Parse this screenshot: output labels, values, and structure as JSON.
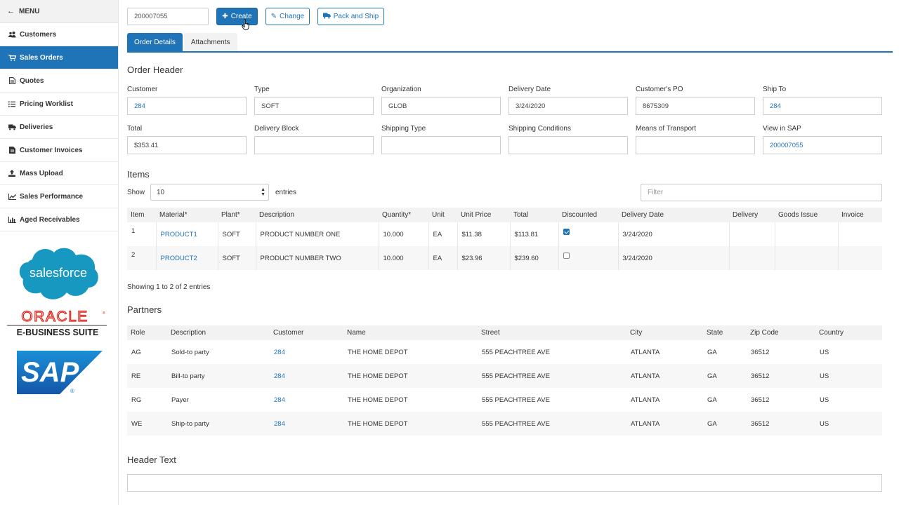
{
  "sidebar": {
    "menu_label": "MENU",
    "items": [
      {
        "label": "Customers",
        "icon": "users-icon",
        "active": false
      },
      {
        "label": "Sales Orders",
        "icon": "cart-icon",
        "active": true
      },
      {
        "label": "Quotes",
        "icon": "file-icon",
        "active": false
      },
      {
        "label": "Pricing Worklist",
        "icon": "list-icon",
        "active": false
      },
      {
        "label": "Deliveries",
        "icon": "truck-icon",
        "active": false
      },
      {
        "label": "Customer Invoices",
        "icon": "invoice-icon",
        "active": false
      },
      {
        "label": "Mass Upload",
        "icon": "upload-icon",
        "active": false
      },
      {
        "label": "Sales Performance",
        "icon": "line-chart-icon",
        "active": false
      },
      {
        "label": "Aged Receivables",
        "icon": "bar-chart-icon",
        "active": false
      }
    ],
    "logos": {
      "salesforce": "salesforce",
      "oracle_top": "ORACLE",
      "oracle_bottom": "E-BUSINESS SUITE",
      "sap": "SAP"
    }
  },
  "toolbar": {
    "order_number": "200007055",
    "create_label": "Create",
    "change_label": "Change",
    "pack_label": "Pack and Ship"
  },
  "tabs": {
    "order_details": "Order Details",
    "attachments": "Attachments"
  },
  "order_header": {
    "title": "Order Header",
    "customer_label": "Customer",
    "customer": "284",
    "type_label": "Type",
    "type": "SOFT",
    "org_label": "Organization",
    "org": "GLOB",
    "delivery_date_label": "Delivery Date",
    "delivery_date": "3/24/2020",
    "po_label": "Customer's PO",
    "po": "8675309",
    "ship_to_label": "Ship To",
    "ship_to": "284",
    "total_label": "Total",
    "total": "$353.41",
    "delivery_block_label": "Delivery Block",
    "delivery_block": "",
    "shipping_type_label": "Shipping Type",
    "shipping_type": "",
    "shipping_cond_label": "Shipping Conditions",
    "shipping_cond": "",
    "transport_label": "Means of Transport",
    "transport": "",
    "sap_label": "View in SAP",
    "sap": "200007055"
  },
  "items": {
    "title": "Items",
    "show_label": "Show",
    "page_size": "10",
    "entries_label": "entries",
    "filter_placeholder": "Filter",
    "columns": [
      "Item",
      "Material*",
      "Plant*",
      "Description",
      "Quantity*",
      "Unit",
      "Unit Price",
      "Total",
      "Discounted",
      "Delivery Date",
      "Delivery",
      "Goods Issue",
      "Invoice"
    ],
    "rows": [
      {
        "item": "1",
        "material": "PRODUCT1",
        "plant": "SOFT",
        "description": "PRODUCT NUMBER ONE",
        "quantity": "10.000",
        "unit": "EA",
        "unit_price": "$11.38",
        "total": "$113.81",
        "discounted": true,
        "delivery_date": "3/24/2020",
        "delivery": "",
        "goods_issue": "",
        "invoice": ""
      },
      {
        "item": "2",
        "material": "PRODUCT2",
        "plant": "SOFT",
        "description": "PRODUCT NUMBER TWO",
        "quantity": "10.000",
        "unit": "EA",
        "unit_price": "$23.96",
        "total": "$239.60",
        "discounted": false,
        "delivery_date": "3/24/2020",
        "delivery": "",
        "goods_issue": "",
        "invoice": ""
      }
    ],
    "showing_text": "Showing 1 to 2 of 2 entries"
  },
  "partners": {
    "title": "Partners",
    "columns": [
      "Role",
      "Description",
      "Customer",
      "Name",
      "Street",
      "City",
      "State",
      "Zip Code",
      "Country"
    ],
    "rows": [
      {
        "role": "AG",
        "description": "Sold-to party",
        "customer": "284",
        "name": "THE HOME DEPOT",
        "street": "555 PEACHTREE AVE",
        "city": "ATLANTA",
        "state": "GA",
        "zip": "36512",
        "country": "US"
      },
      {
        "role": "RE",
        "description": "Bill-to party",
        "customer": "284",
        "name": "THE HOME DEPOT",
        "street": "555 PEACHTREE AVE",
        "city": "ATLANTA",
        "state": "GA",
        "zip": "36512",
        "country": "US"
      },
      {
        "role": "RG",
        "description": "Payer",
        "customer": "284",
        "name": "THE HOME DEPOT",
        "street": "555 PEACHTREE AVE",
        "city": "ATLANTA",
        "state": "GA",
        "zip": "36512",
        "country": "US"
      },
      {
        "role": "WE",
        "description": "Ship-to party",
        "customer": "284",
        "name": "THE HOME DEPOT",
        "street": "555 PEACHTREE AVE",
        "city": "ATLANTA",
        "state": "GA",
        "zip": "36512",
        "country": "US"
      }
    ]
  },
  "header_text": {
    "title": "Header Text",
    "value": ""
  },
  "colors": {
    "accent": "#1f73b7",
    "salesforce": "#1798c1",
    "oracle": "#e0241b",
    "sap": "#1a6fbe"
  }
}
